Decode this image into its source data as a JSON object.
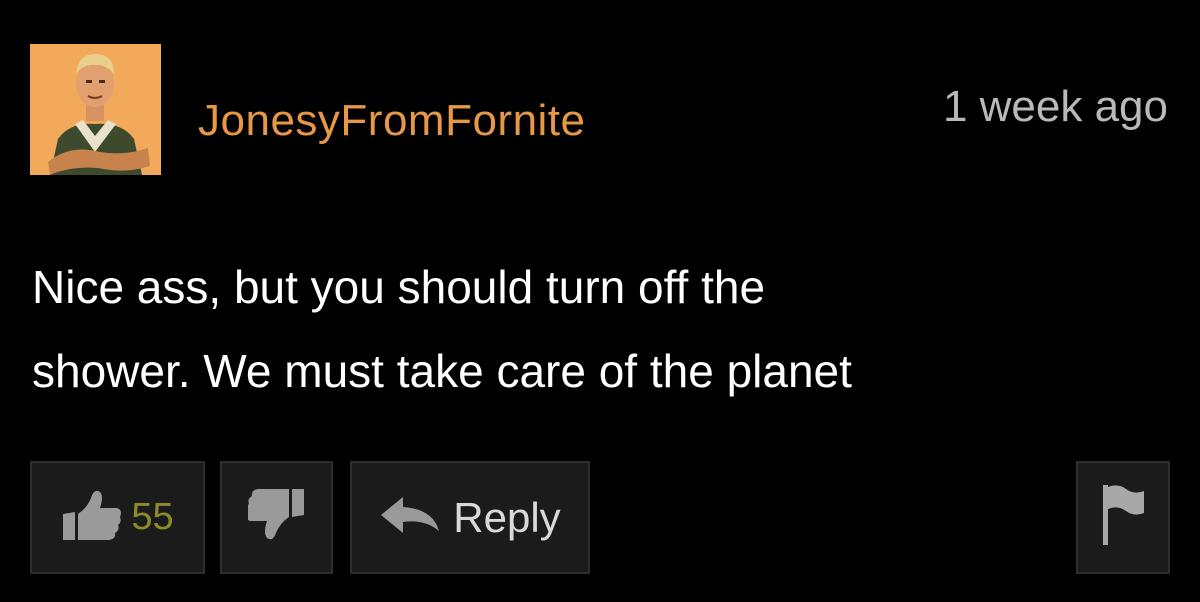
{
  "comment": {
    "username": "JonesyFromFornite",
    "timestamp": "1 week ago",
    "body_lines": [
      "Nice ass, but you should turn off the",
      "shower. We must take care of the planet"
    ]
  },
  "actions": {
    "like_count": "55",
    "reply_label": "Reply",
    "icons": {
      "like": "thumbs-up-icon",
      "dislike": "thumbs-down-icon",
      "reply": "reply-arrow-icon",
      "flag": "flag-icon"
    }
  },
  "colors": {
    "background": "#000000",
    "username": "#e79845",
    "timestamp": "#b9b9b9",
    "like_count": "#8b8b2a",
    "button_bg": "#1b1b1b",
    "avatar_bg": "#f2a95a"
  }
}
